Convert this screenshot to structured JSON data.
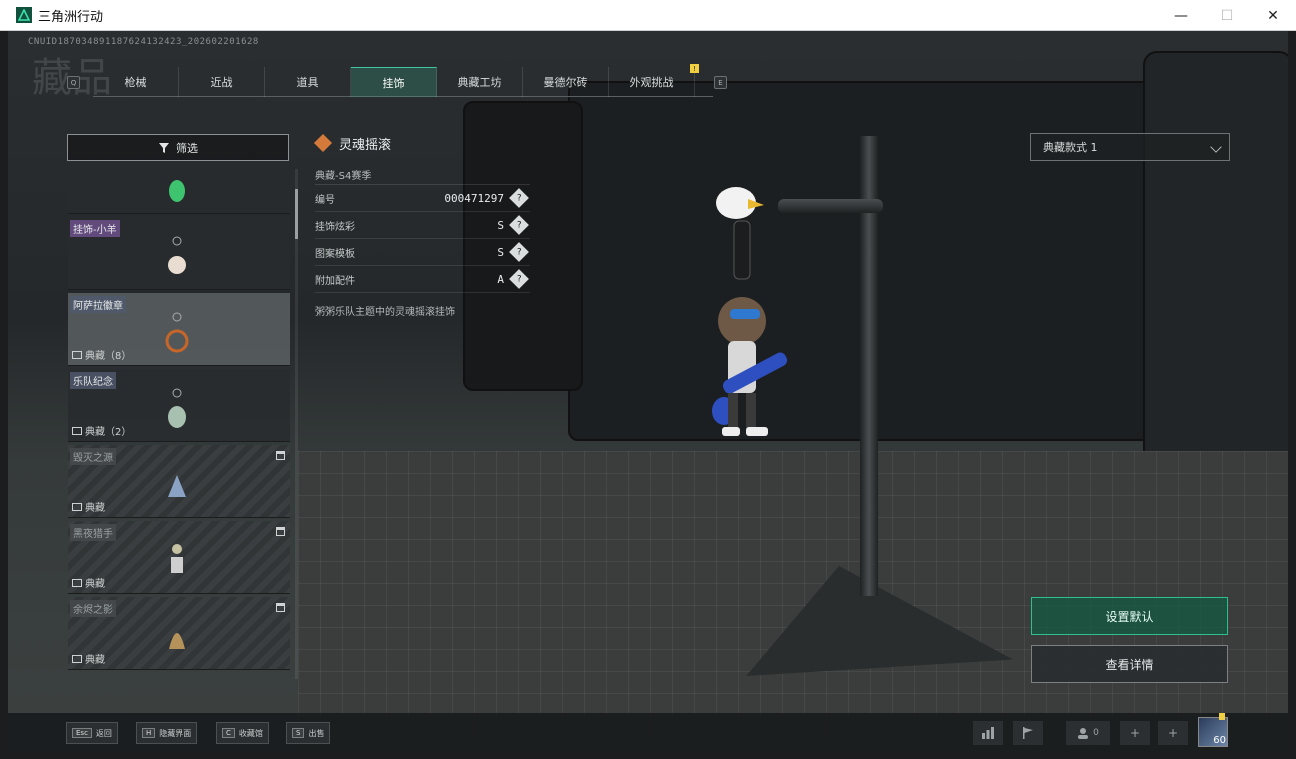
{
  "window": {
    "title": "三角洲行动",
    "minimize_glyph": "—",
    "maximize_glyph": "☐",
    "close_glyph": "✕"
  },
  "uid_text": "CNUID187034891187624132423_202602201628",
  "page_heading": "藏品",
  "tabs": [
    {
      "label": "枪械",
      "active": false
    },
    {
      "label": "近战",
      "active": false
    },
    {
      "label": "道具",
      "active": false
    },
    {
      "label": "挂饰",
      "active": true
    },
    {
      "label": "典藏工坊",
      "active": false
    },
    {
      "label": "曼德尔砖",
      "active": false
    },
    {
      "label": "外观挑战",
      "active": false
    }
  ],
  "tab_nav": {
    "prev_key": "Q",
    "next_key": "E",
    "badge": "!"
  },
  "filter": {
    "label": "筛选",
    "icon": "filter-icon"
  },
  "list_items": [
    {
      "name": "",
      "footer": "",
      "locked": false,
      "selected": false,
      "color": "#3ec46e"
    },
    {
      "name": "挂饰-小羊",
      "footer": "",
      "locked": false,
      "selected": false,
      "color": "#e9dcd0"
    },
    {
      "name": "阿萨拉徽章",
      "footer": "典藏（8）",
      "locked": false,
      "selected": true,
      "color": "#c8662a"
    },
    {
      "name": "乐队纪念",
      "footer": "典藏（2）",
      "locked": false,
      "selected": false,
      "color": "#a8c0b0"
    },
    {
      "name": "毁灭之源",
      "footer": "典藏",
      "locked": true,
      "selected": false,
      "color": "#8aa2c4"
    },
    {
      "name": "黑夜猎手",
      "footer": "典藏",
      "locked": true,
      "selected": false,
      "color": "#c7c2a2"
    },
    {
      "name": "余烬之影",
      "footer": "典藏",
      "locked": true,
      "selected": false,
      "color": "#b4925a"
    }
  ],
  "detail": {
    "title": "灵魂摇滚",
    "season": "典藏-S4赛季",
    "rows": [
      {
        "label": "编号",
        "value": "000471297"
      },
      {
        "label": "挂饰炫彩",
        "value": "S"
      },
      {
        "label": "图案模板",
        "value": "S"
      },
      {
        "label": "附加配件",
        "value": "A"
      }
    ],
    "description": "粥粥乐队主题中的灵魂摇滚挂饰"
  },
  "style_select": {
    "value": "典藏款式 1"
  },
  "actions": {
    "set_default": "设置默认",
    "view_details": "查看详情"
  },
  "hotkeys": [
    {
      "key": "Esc",
      "label": "返回"
    },
    {
      "key": "H",
      "label": "隐藏界面"
    },
    {
      "key": "C",
      "label": "收藏馆"
    },
    {
      "key": "S",
      "label": "出售"
    }
  ],
  "social": {
    "friends_count": "0",
    "level": "60"
  },
  "colors": {
    "accent": "#2fbf8e",
    "badge": "#f0d040",
    "rarity_orange": "#d47a3a"
  },
  "icons": {
    "stats": "bar-chart-icon",
    "flag": "flag-icon",
    "friends": "friends-icon",
    "add": "plus-icon",
    "lock": "lock-icon",
    "image": "image-icon",
    "help": "question-icon"
  }
}
